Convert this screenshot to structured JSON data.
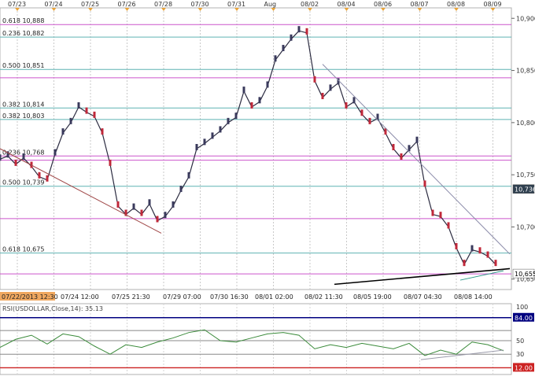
{
  "chart_data": [
    {
      "type": "line",
      "symbol": "USDOLLAR",
      "y_axis_side": "right",
      "ylim": [
        10640,
        10910
      ],
      "y_ticks": [
        "10,900",
        "10,850",
        "10,800",
        "10,750",
        "10,700",
        "10,650"
      ],
      "top_date_labels": [
        "07/23",
        "07/24",
        "07/25",
        "07/26",
        "07/28",
        "07/30",
        "07/31",
        "Aug",
        "08/02",
        "08/04",
        "08/06",
        "08/07",
        "08/08",
        "08/09"
      ],
      "bottom_time_labels": [
        "07/22/2013 12:30",
        "07/24 12:00",
        "07/25 21:30",
        "07/29 07:00",
        "07/30 16:30",
        "08/01 02:00",
        "08/02 11:30",
        "08/05 19:00",
        "08/07 04:30",
        "08/08 14:00"
      ],
      "fib_levels": [
        {
          "label": "0.618 10,888",
          "value": 10894,
          "color": "#cc55cc"
        },
        {
          "label": "0.236 10,882",
          "value": 10882,
          "color": "#5fb3b3"
        },
        {
          "label": "0.500 10,851",
          "value": 10851,
          "color": "#5fb3b3"
        },
        {
          "value": 10843,
          "color": "#cc55cc"
        },
        {
          "label": "0.382 10,814",
          "value": 10814,
          "color": "#5fb3b3"
        },
        {
          "label": "0.382 10,803",
          "value": 10803,
          "color": "#5fb3b3"
        },
        {
          "label": "0.236 10,768",
          "value": 10768,
          "color": "#cc55cc"
        },
        {
          "value": 10764,
          "color": "#cc55cc"
        },
        {
          "label": "0.500 10,739",
          "value": 10739,
          "color": "#5fb3b3"
        },
        {
          "value": 10708,
          "color": "#cc55cc"
        },
        {
          "label": "0.618 10,675",
          "value": 10675,
          "color": "#5fb3b3"
        },
        {
          "value": 10655,
          "color": "#cc55cc"
        }
      ],
      "price_path": [
        {
          "x": 0,
          "y": 10765
        },
        {
          "x": 10,
          "y": 10768
        },
        {
          "x": 20,
          "y": 10760
        },
        {
          "x": 30,
          "y": 10766
        },
        {
          "x": 40,
          "y": 10758
        },
        {
          "x": 50,
          "y": 10748
        },
        {
          "x": 60,
          "y": 10745
        },
        {
          "x": 70,
          "y": 10770
        },
        {
          "x": 80,
          "y": 10790
        },
        {
          "x": 90,
          "y": 10800
        },
        {
          "x": 100,
          "y": 10815
        },
        {
          "x": 110,
          "y": 10810
        },
        {
          "x": 120,
          "y": 10806
        },
        {
          "x": 130,
          "y": 10790
        },
        {
          "x": 140,
          "y": 10760
        },
        {
          "x": 150,
          "y": 10720
        },
        {
          "x": 160,
          "y": 10712
        },
        {
          "x": 170,
          "y": 10718
        },
        {
          "x": 180,
          "y": 10712
        },
        {
          "x": 190,
          "y": 10722
        },
        {
          "x": 200,
          "y": 10706
        },
        {
          "x": 210,
          "y": 10710
        },
        {
          "x": 220,
          "y": 10720
        },
        {
          "x": 230,
          "y": 10735
        },
        {
          "x": 240,
          "y": 10748
        },
        {
          "x": 250,
          "y": 10775
        },
        {
          "x": 260,
          "y": 10780
        },
        {
          "x": 270,
          "y": 10786
        },
        {
          "x": 280,
          "y": 10792
        },
        {
          "x": 290,
          "y": 10800
        },
        {
          "x": 300,
          "y": 10805
        },
        {
          "x": 310,
          "y": 10830
        },
        {
          "x": 320,
          "y": 10815
        },
        {
          "x": 330,
          "y": 10820
        },
        {
          "x": 340,
          "y": 10835
        },
        {
          "x": 350,
          "y": 10860
        },
        {
          "x": 360,
          "y": 10870
        },
        {
          "x": 370,
          "y": 10880
        },
        {
          "x": 380,
          "y": 10888
        },
        {
          "x": 390,
          "y": 10886
        },
        {
          "x": 400,
          "y": 10840
        },
        {
          "x": 410,
          "y": 10824
        },
        {
          "x": 420,
          "y": 10832
        },
        {
          "x": 430,
          "y": 10838
        },
        {
          "x": 440,
          "y": 10815
        },
        {
          "x": 450,
          "y": 10820
        },
        {
          "x": 460,
          "y": 10808
        },
        {
          "x": 470,
          "y": 10800
        },
        {
          "x": 480,
          "y": 10804
        },
        {
          "x": 490,
          "y": 10790
        },
        {
          "x": 500,
          "y": 10775
        },
        {
          "x": 510,
          "y": 10766
        },
        {
          "x": 520,
          "y": 10774
        },
        {
          "x": 530,
          "y": 10782
        },
        {
          "x": 540,
          "y": 10740
        },
        {
          "x": 550,
          "y": 10712
        },
        {
          "x": 560,
          "y": 10710
        },
        {
          "x": 570,
          "y": 10700
        },
        {
          "x": 580,
          "y": 10680
        },
        {
          "x": 590,
          "y": 10664
        },
        {
          "x": 600,
          "y": 10678
        },
        {
          "x": 610,
          "y": 10676
        },
        {
          "x": 620,
          "y": 10672
        },
        {
          "x": 630,
          "y": 10664
        }
      ],
      "trendlines": [
        {
          "color": "#a04848",
          "from": {
            "x": 0,
            "y": 10775
          },
          "to": {
            "x": 205,
            "y": 10694
          }
        },
        {
          "color": "#8c8caa",
          "from": {
            "x": 410,
            "y": 10856
          },
          "to": {
            "x": 648,
            "y": 10674
          }
        },
        {
          "color": "#000000",
          "from": {
            "x": 425,
            "y": 10645
          },
          "to": {
            "x": 648,
            "y": 10660
          }
        },
        {
          "color": "#2f9a8a",
          "from": {
            "x": 585,
            "y": 10649
          },
          "to": {
            "x": 640,
            "y": 10658
          }
        }
      ],
      "price_badges": [
        {
          "text": "10,736",
          "value": 10736,
          "bg": "#2f3f4f",
          "fg": "#ffffff"
        },
        {
          "text": "10,655",
          "value": 10655,
          "bg": "#ffffff",
          "fg": "#000000"
        }
      ]
    },
    {
      "type": "line",
      "title": "RSI(USDOLLAR,Close,14): 35.13",
      "ylim": [
        0,
        100
      ],
      "y_ticks": [
        "100",
        "50",
        "30"
      ],
      "levels": [
        {
          "value": 84,
          "color": "#000080",
          "label": "84.00"
        },
        {
          "value": 65,
          "color": "#888888"
        },
        {
          "value": 50,
          "color": "#888888"
        },
        {
          "value": 30,
          "color": "#888888"
        },
        {
          "value": 10,
          "color": "#cc2222",
          "label": "12.00"
        }
      ],
      "rsi_path": [
        {
          "x": 0,
          "y": 40
        },
        {
          "x": 20,
          "y": 52
        },
        {
          "x": 40,
          "y": 58
        },
        {
          "x": 60,
          "y": 45
        },
        {
          "x": 80,
          "y": 60
        },
        {
          "x": 100,
          "y": 56
        },
        {
          "x": 120,
          "y": 42
        },
        {
          "x": 140,
          "y": 30
        },
        {
          "x": 160,
          "y": 44
        },
        {
          "x": 180,
          "y": 40
        },
        {
          "x": 200,
          "y": 48
        },
        {
          "x": 220,
          "y": 54
        },
        {
          "x": 240,
          "y": 62
        },
        {
          "x": 260,
          "y": 66
        },
        {
          "x": 280,
          "y": 50
        },
        {
          "x": 300,
          "y": 48
        },
        {
          "x": 320,
          "y": 54
        },
        {
          "x": 340,
          "y": 60
        },
        {
          "x": 360,
          "y": 62
        },
        {
          "x": 380,
          "y": 58
        },
        {
          "x": 400,
          "y": 38
        },
        {
          "x": 420,
          "y": 44
        },
        {
          "x": 440,
          "y": 40
        },
        {
          "x": 460,
          "y": 46
        },
        {
          "x": 480,
          "y": 42
        },
        {
          "x": 500,
          "y": 38
        },
        {
          "x": 520,
          "y": 46
        },
        {
          "x": 540,
          "y": 28
        },
        {
          "x": 560,
          "y": 36
        },
        {
          "x": 580,
          "y": 30
        },
        {
          "x": 600,
          "y": 48
        },
        {
          "x": 620,
          "y": 44
        },
        {
          "x": 640,
          "y": 35
        }
      ],
      "support_line": {
        "from": {
          "x": 535,
          "y": 22
        },
        "to": {
          "x": 640,
          "y": 36
        }
      }
    }
  ]
}
